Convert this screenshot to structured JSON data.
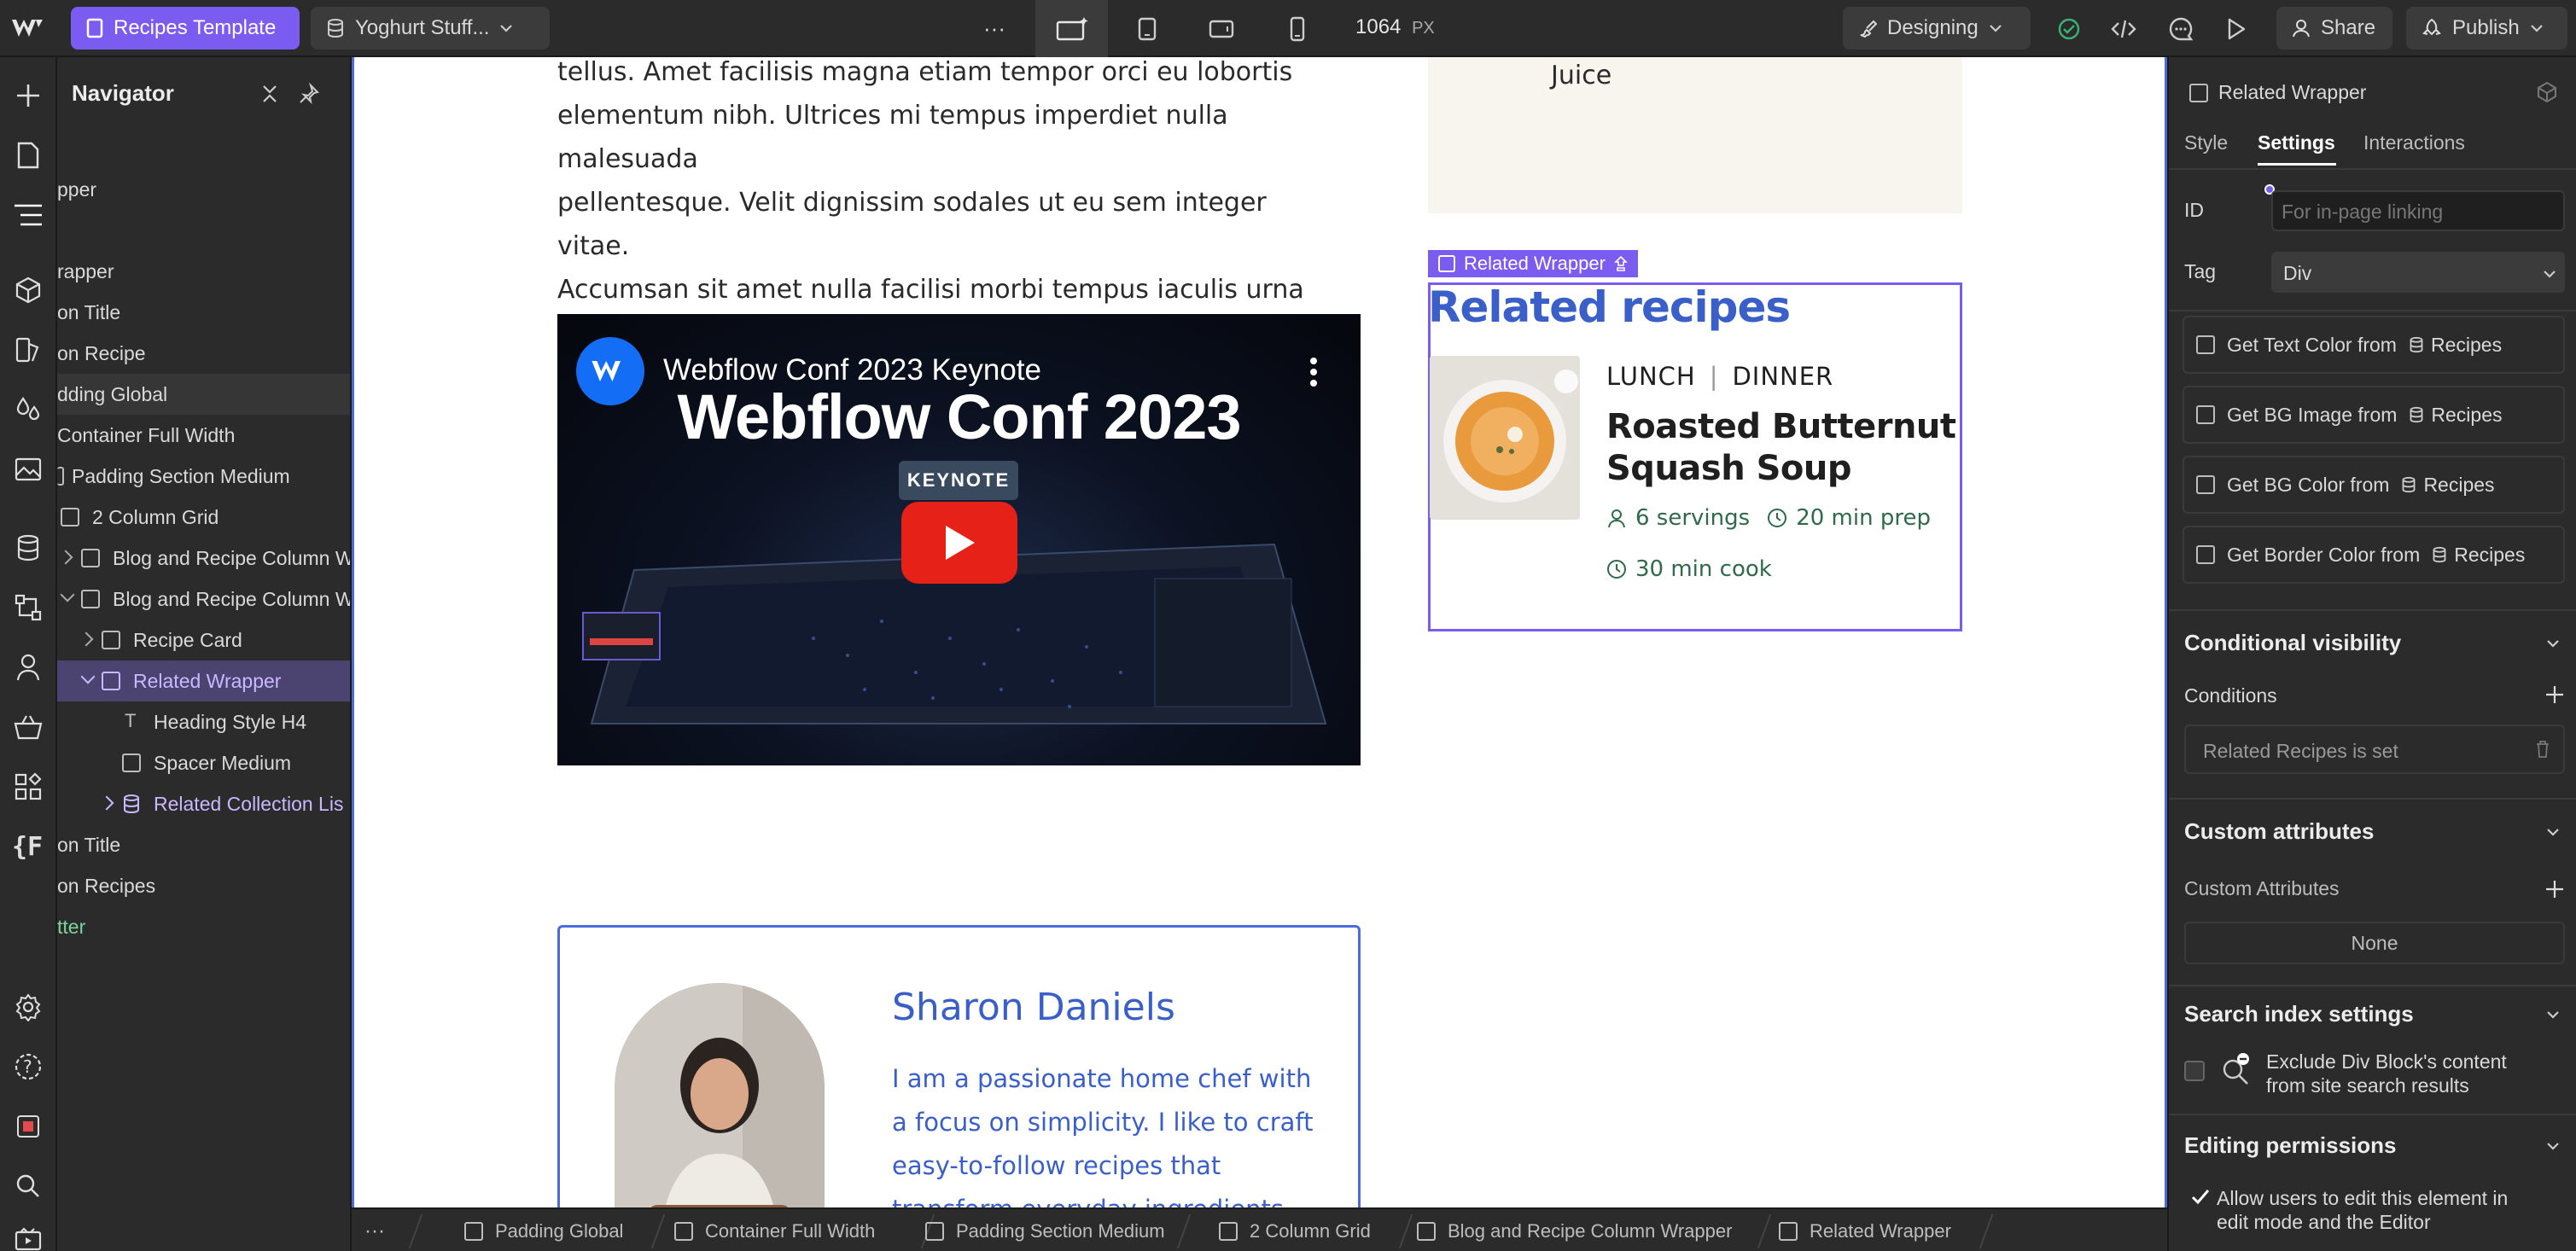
{
  "topbar": {
    "page_button": "Recipes Template",
    "collection_button": "Yoghurt Stuff...",
    "more": "···",
    "width_value": "1064",
    "width_unit": "PX",
    "mode_button": "Designing",
    "share_button": "Share",
    "publish_button": "Publish"
  },
  "navigator": {
    "title": "Navigator",
    "rows": [
      {
        "label": "pper"
      },
      {
        "label": "rapper"
      },
      {
        "label": "on Title"
      },
      {
        "label": "on Recipe"
      },
      {
        "label": "dding Global"
      },
      {
        "label": "Container Full Width"
      },
      {
        "label": "Padding Section Medium"
      },
      {
        "label": "2 Column Grid"
      },
      {
        "label": "Blog and Recipe Column W"
      },
      {
        "label": "Blog and Recipe Column W"
      },
      {
        "label": "Recipe Card"
      },
      {
        "label": "Related Wrapper"
      },
      {
        "label": "Heading Style H4"
      },
      {
        "label": "Spacer Medium"
      },
      {
        "label": "Related Collection Lis"
      },
      {
        "label": "on Title"
      },
      {
        "label": "on Recipes"
      },
      {
        "label": "tter"
      }
    ]
  },
  "canvas": {
    "paragraph_lines": [
      "tellus. Amet facilisis magna etiam tempor orci eu lobortis",
      "elementum nibh. Ultrices mi tempus imperdiet nulla malesuada",
      "pellentesque. Velit dignissim sodales ut eu sem integer vitae.",
      "Accumsan sit amet nulla facilisi morbi tempus iaculis urna id."
    ],
    "sidebar_card_text": "Juice",
    "video": {
      "channel_title": "Webflow Conf 2023 Keynote",
      "headline": "Webflow Conf 2023",
      "badge": "KEYNOTE"
    },
    "selection_label": "Related Wrapper",
    "related_heading": "Related recipes",
    "related_card": {
      "category_1": "LUNCH",
      "category_2": "DINNER",
      "title_line_1": "Roasted Butternut",
      "title_line_2": "Squash Soup",
      "servings": "6 servings",
      "prep": "20 min prep",
      "cook": "30 min cook"
    },
    "author": {
      "name": "Sharon Daniels",
      "bio_lines": [
        "I am a passionate home chef with",
        "a focus on simplicity. I like to craft",
        "easy-to-follow recipes that",
        "transform everyday ingredients"
      ]
    }
  },
  "breadcrumbs": {
    "more": "···",
    "items": [
      "Padding Global",
      "Container Full Width",
      "Padding Section Medium",
      "2 Column Grid",
      "Blog and Recipe Column Wrapper",
      "Related Wrapper"
    ]
  },
  "panel": {
    "element_name": "Related Wrapper",
    "tabs": [
      "Style",
      "Settings",
      "Interactions"
    ],
    "id_label": "ID",
    "id_placeholder": "For in-page linking",
    "tag_label": "Tag",
    "tag_value": "Div",
    "bindings": [
      {
        "label": "Get Text Color from",
        "source": "Recipes"
      },
      {
        "label": "Get BG Image from",
        "source": "Recipes"
      },
      {
        "label": "Get BG Color from",
        "source": "Recipes"
      },
      {
        "label": "Get Border Color from",
        "source": "Recipes"
      }
    ],
    "conditional_visibility": "Conditional visibility",
    "conditions_label": "Conditions",
    "condition_value": "Related Recipes is set",
    "custom_attributes_title": "Custom attributes",
    "custom_attributes_label": "Custom Attributes",
    "custom_attributes_value": "None",
    "search_index_title": "Search index settings",
    "search_index_line1": "Exclude Div Block's content",
    "search_index_line2": "from site search results",
    "editing_title": "Editing permissions",
    "editing_line1": "Allow users to edit this element in",
    "editing_line2": "edit mode and the Editor"
  },
  "colors": {
    "accent_purple": "#7b5cf0",
    "selection_blue": "#4a6bd8",
    "recipe_green": "#2f6b4a",
    "author_blue": "#3a5fc9"
  }
}
